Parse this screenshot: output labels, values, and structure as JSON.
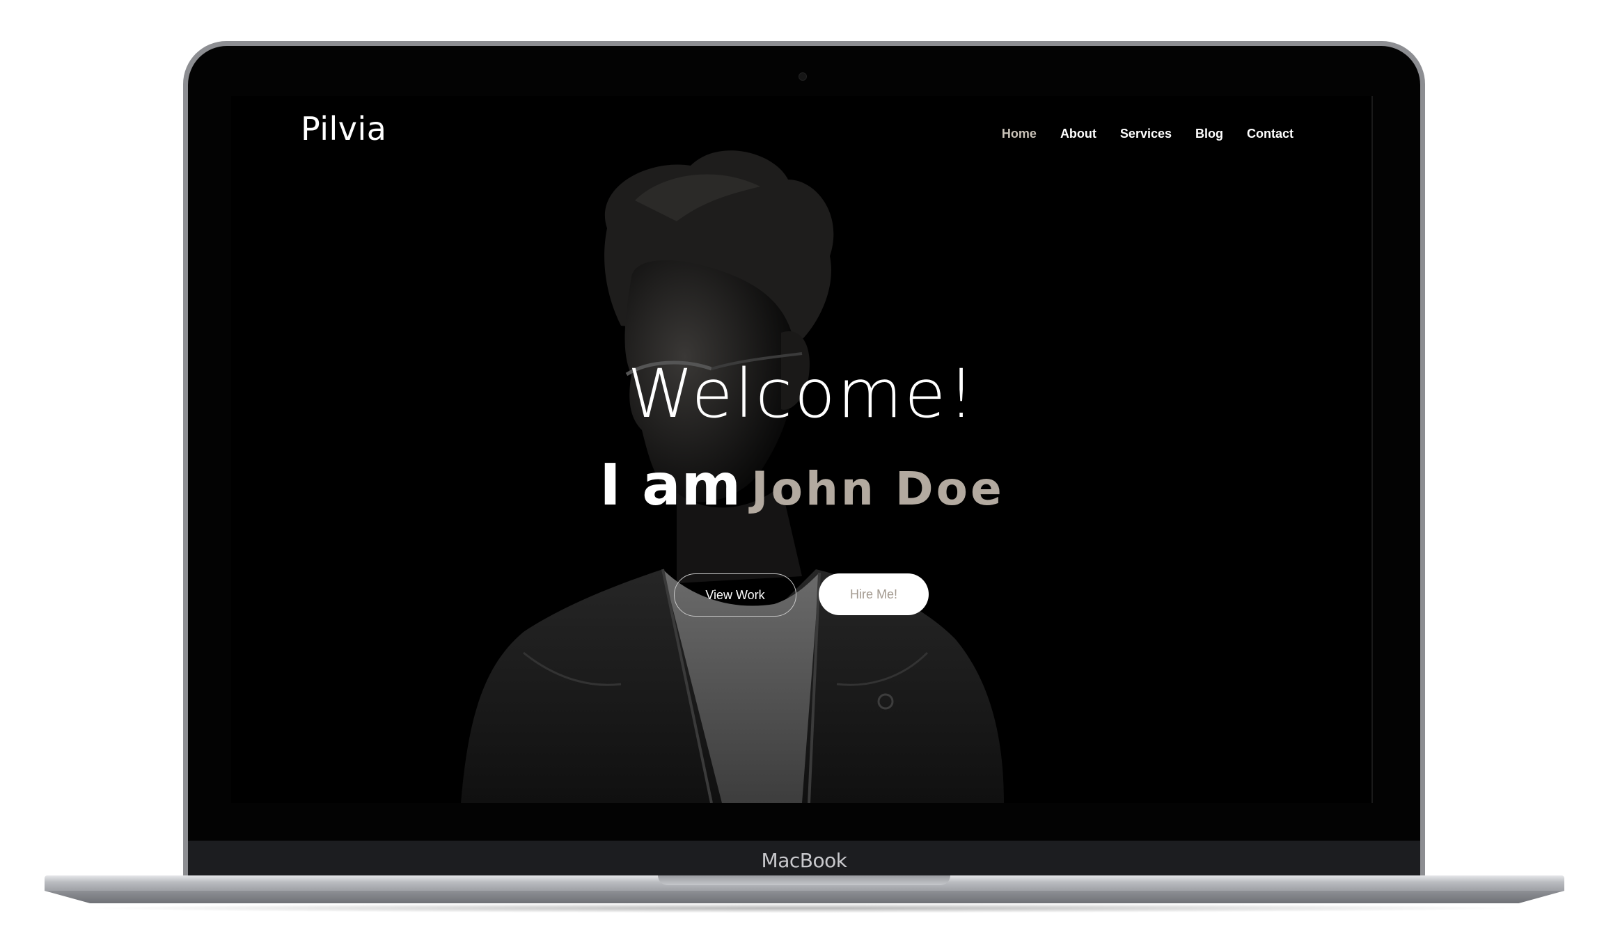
{
  "site": {
    "logo": "Pilvia",
    "nav": [
      {
        "label": "Home",
        "active": true
      },
      {
        "label": "About"
      },
      {
        "label": "Services"
      },
      {
        "label": "Blog"
      },
      {
        "label": "Contact"
      }
    ]
  },
  "hero": {
    "welcome": "Welcome!",
    "lead": "I am",
    "name": "John Doe",
    "buttons": {
      "view_work": "View Work",
      "hire_me": "Hire Me!"
    }
  },
  "device": {
    "brand_label": "MacBook"
  },
  "colors": {
    "accent_name": "#b3aaa0",
    "nav_active": "#c9c2b8",
    "background": "#000000"
  }
}
